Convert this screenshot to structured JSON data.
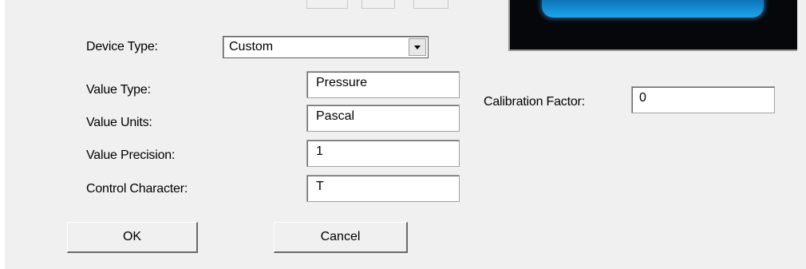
{
  "form": {
    "device_type": {
      "label": "Device Type:",
      "value": "Custom"
    },
    "value_type": {
      "label": "Value Type:",
      "value": "Pressure"
    },
    "value_units": {
      "label": "Value Units:",
      "value": "Pascal"
    },
    "value_precision": {
      "label": "Value Precision:",
      "value": "1"
    },
    "control_character": {
      "label": "Control Character:",
      "value": "T"
    },
    "calibration_factor": {
      "label": "Calibration Factor:",
      "value": "0"
    }
  },
  "buttons": {
    "ok": "OK",
    "cancel": "Cancel"
  },
  "icons": {
    "dropdown": "chevron-down-icon"
  },
  "colors": {
    "dialog_bg": "#f0f0f0",
    "preview_bg": "#05070a",
    "preview_glow": "#1aa6ee"
  }
}
